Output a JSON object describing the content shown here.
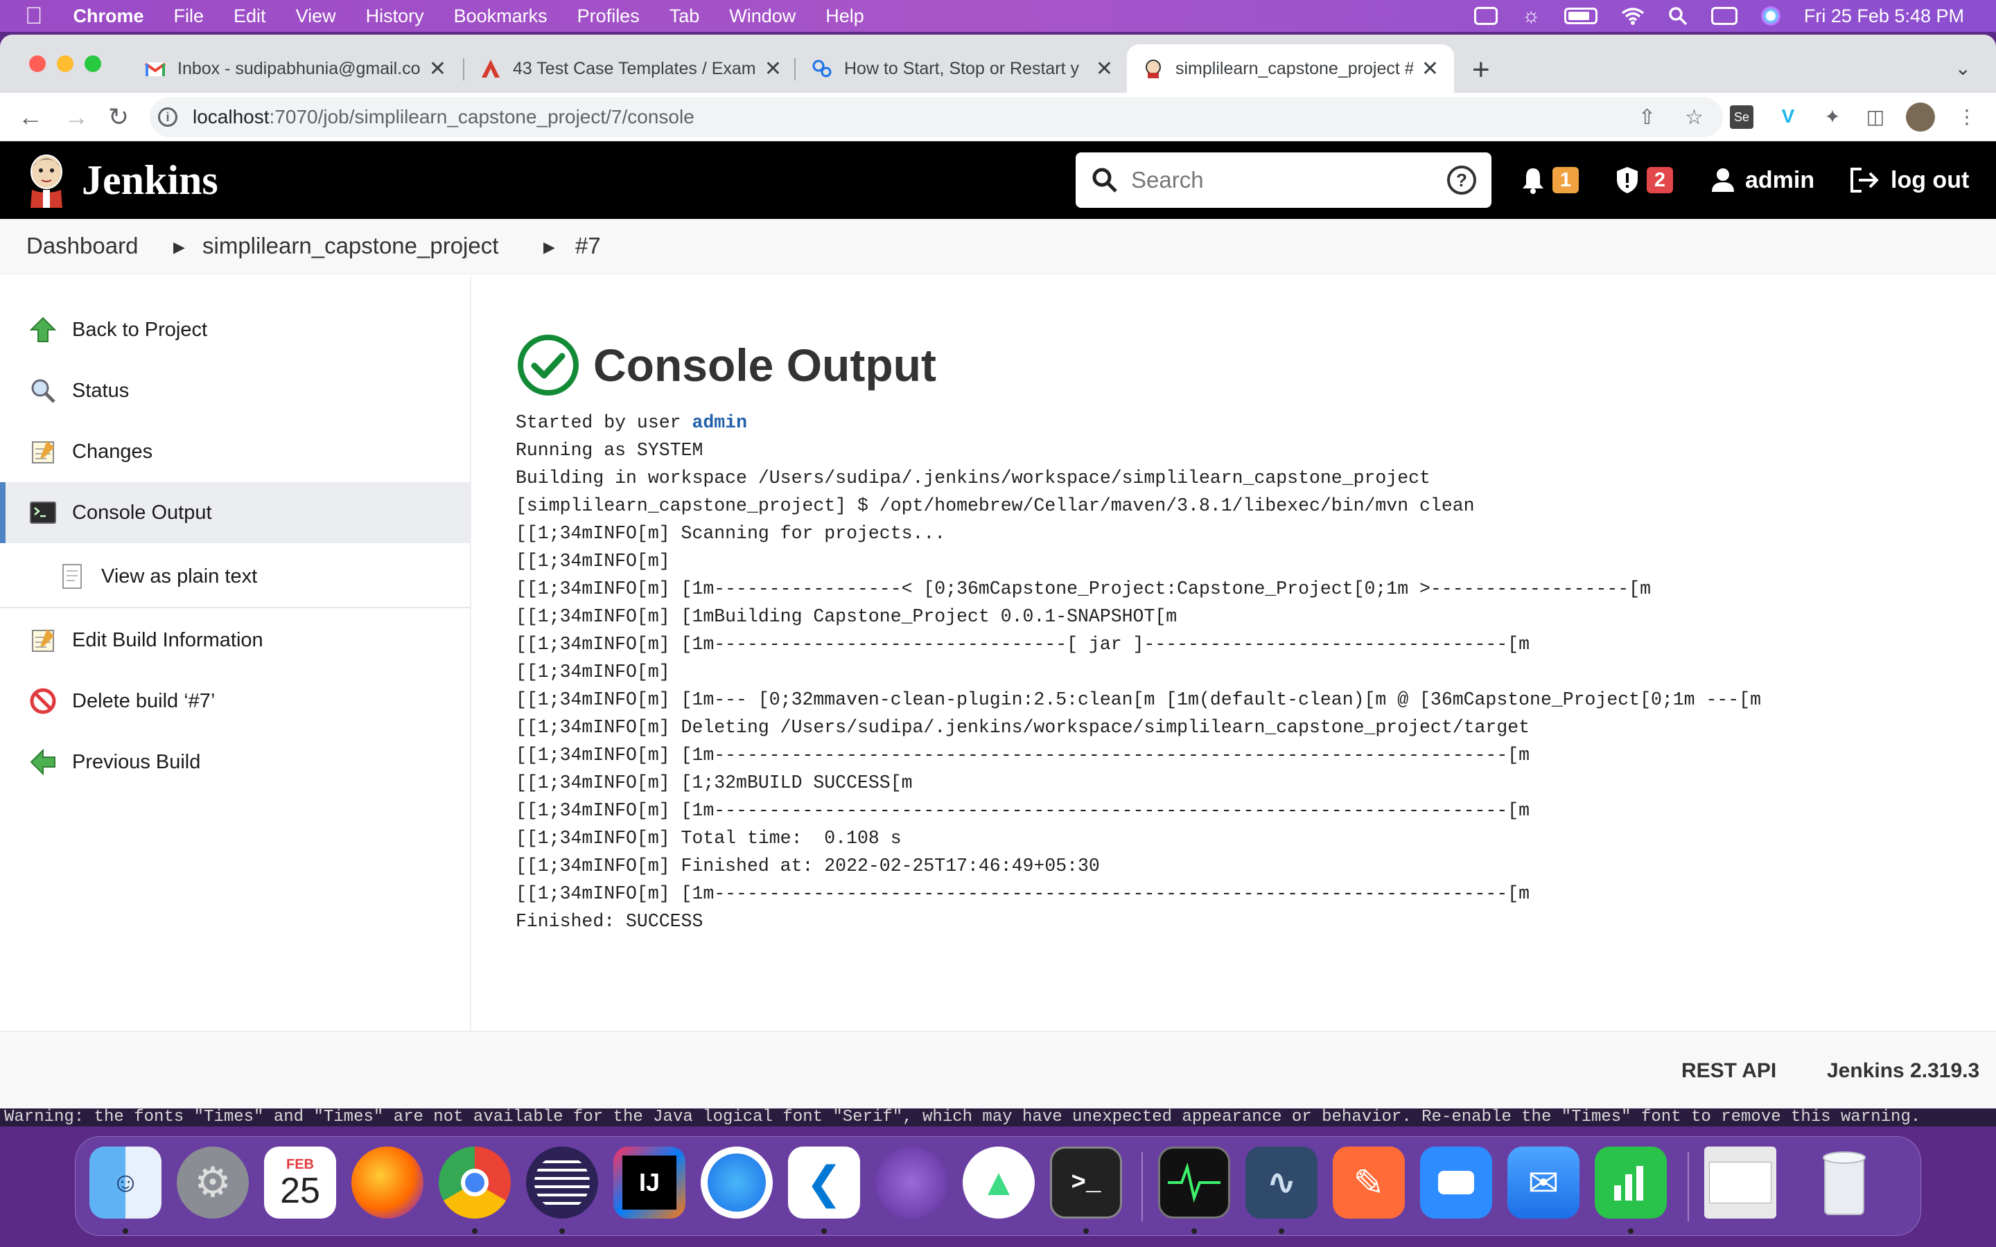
{
  "menubar": {
    "app": "Chrome",
    "items": [
      "File",
      "Edit",
      "View",
      "History",
      "Bookmarks",
      "Profiles",
      "Tab",
      "Window",
      "Help"
    ],
    "datetime": "Fri 25 Feb  5:48 PM"
  },
  "tabs": [
    {
      "title": "Inbox - sudipabhunia@gmail.co",
      "favicon": "gmail-icon"
    },
    {
      "title": "43 Test Case Templates / Exam",
      "favicon": "document-icon"
    },
    {
      "title": "How to Start, Stop or Restart y",
      "favicon": "gears-icon"
    },
    {
      "title": "simplilearn_capstone_project #",
      "favicon": "jenkins-icon"
    }
  ],
  "address": {
    "host": "localhost",
    "path": ":7070/job/simplilearn_capstone_project/7/console"
  },
  "jenkins": {
    "title": "Jenkins",
    "search_placeholder": "Search",
    "notifications": "1",
    "security": "2",
    "user": "admin",
    "logout": "log out"
  },
  "breadcrumb": {
    "dashboard": "Dashboard",
    "project": "simplilearn_capstone_project",
    "build": "#7"
  },
  "sidebar": {
    "back": "Back to Project",
    "status": "Status",
    "changes": "Changes",
    "console": "Console Output",
    "plain": "View as plain text",
    "edit": "Edit Build Information",
    "delete": "Delete build ‘#7’",
    "previous": "Previous Build"
  },
  "console": {
    "title": "Console Output",
    "started_prefix": "Started by user ",
    "started_user": "admin",
    "lines": [
      "Running as SYSTEM",
      "Building in workspace /Users/sudipa/.jenkins/workspace/simplilearn_capstone_project",
      "[simplilearn_capstone_project] $ /opt/homebrew/Cellar/maven/3.8.1/libexec/bin/mvn clean",
      "[[1;34mINFO[m] Scanning for projects...",
      "[[1;34mINFO[m]",
      "[[1;34mINFO[m] [1m-----------------< [0;36mCapstone_Project:Capstone_Project[0;1m >------------------[m",
      "[[1;34mINFO[m] [1mBuilding Capstone_Project 0.0.1-SNAPSHOT[m",
      "[[1;34mINFO[m] [1m--------------------------------[ jar ]---------------------------------[m",
      "[[1;34mINFO[m]",
      "[[1;34mINFO[m] [1m--- [0;32mmaven-clean-plugin:2.5:clean[m [1m(default-clean)[m @ [36mCapstone_Project[0;1m ---[m",
      "[[1;34mINFO[m] Deleting /Users/sudipa/.jenkins/workspace/simplilearn_capstone_project/target",
      "[[1;34mINFO[m] [1m------------------------------------------------------------------------[m",
      "[[1;34mINFO[m] [1;32mBUILD SUCCESS[m",
      "[[1;34mINFO[m] [1m------------------------------------------------------------------------[m",
      "[[1;34mINFO[m] Total time:  0.108 s",
      "[[1;34mINFO[m] Finished at: 2022-02-25T17:46:49+05:30",
      "[[1;34mINFO[m] [1m------------------------------------------------------------------------[m",
      "Finished: SUCCESS"
    ]
  },
  "footer": {
    "rest_api": "REST API",
    "version": "Jenkins 2.319.3"
  },
  "terminal_strip": "Warning: the fonts \"Times\" and \"Times\" are not available for the Java logical font \"Serif\", which may have unexpected appearance or behavior. Re-enable the \"Times\" font to remove this warning.",
  "dock": {
    "calendar_month": "FEB",
    "calendar_day": "25",
    "apps": [
      "finder-icon",
      "system-preferences-icon",
      "calendar-icon",
      "firefox-icon",
      "chrome-icon",
      "eclipse-icon",
      "intellij-icon",
      "safari-icon",
      "vscode-icon",
      "tor-icon",
      "android-studio-icon",
      "terminal-icon",
      "activity-monitor-icon",
      "mysql-workbench-icon",
      "postman-icon",
      "zoom-icon",
      "mail-icon",
      "numbers-icon",
      "downloads-stack-icon",
      "trash-icon"
    ]
  },
  "colors": {
    "jenkins_header": "#000000",
    "success_green": "#138a36",
    "link_blue": "#2361ab",
    "active_border": "#4f84c4",
    "badge_orange": "#f0a240",
    "badge_red": "#e2474b"
  }
}
